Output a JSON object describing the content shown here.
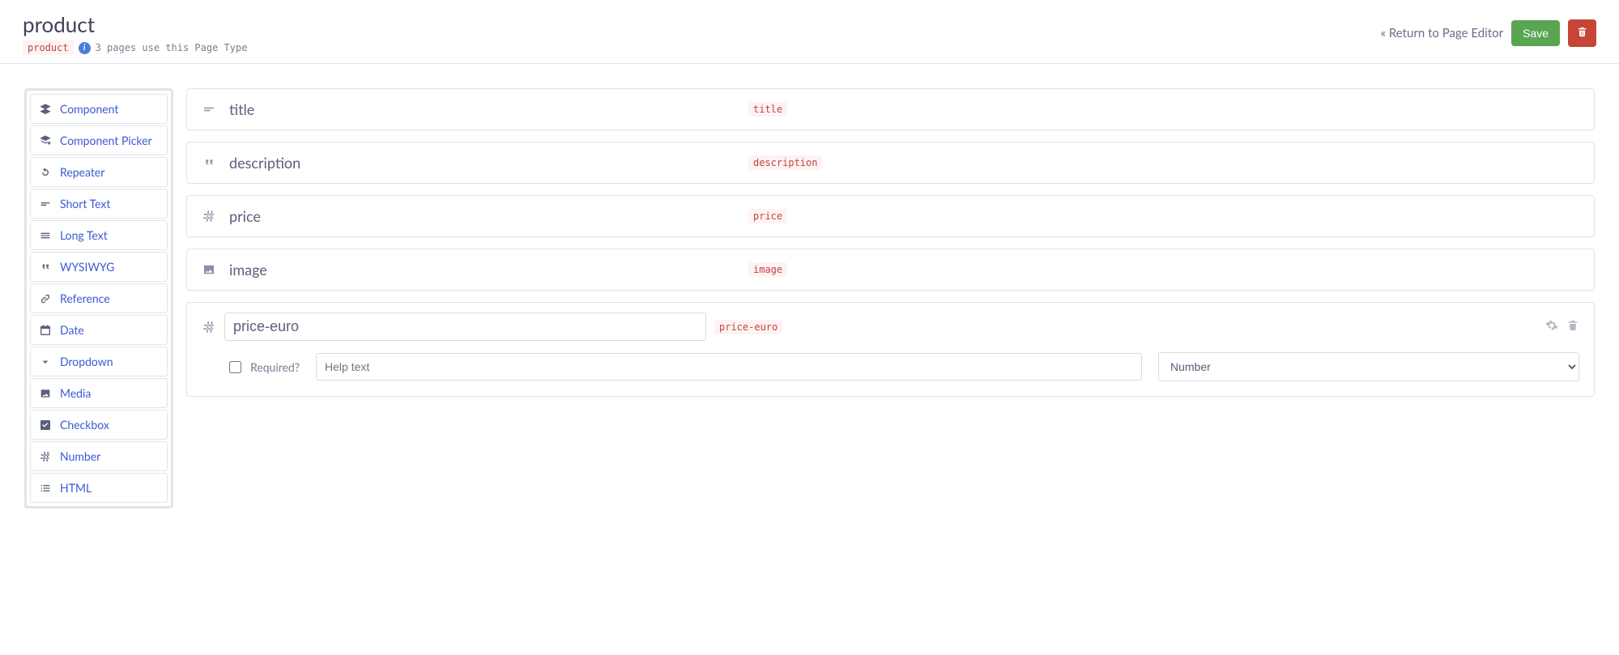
{
  "header": {
    "title": "product",
    "slug": "product",
    "usage_text": "3 pages use this Page Type",
    "return_label": "« Return to Page Editor",
    "save_label": "Save"
  },
  "sidebar": {
    "items": [
      {
        "icon": "layers-icon",
        "label": "Component"
      },
      {
        "icon": "layers-plus-icon",
        "label": "Component Picker"
      },
      {
        "icon": "refresh-icon",
        "label": "Repeater"
      },
      {
        "icon": "short-text-icon",
        "label": "Short Text"
      },
      {
        "icon": "long-text-icon",
        "label": "Long Text"
      },
      {
        "icon": "quote-icon",
        "label": "WYSIWYG"
      },
      {
        "icon": "link-icon",
        "label": "Reference"
      },
      {
        "icon": "calendar-icon",
        "label": "Date"
      },
      {
        "icon": "chevron-down-icon",
        "label": "Dropdown"
      },
      {
        "icon": "image-icon",
        "label": "Media"
      },
      {
        "icon": "checkbox-icon",
        "label": "Checkbox"
      },
      {
        "icon": "hash-icon",
        "label": "Number"
      },
      {
        "icon": "list-icon",
        "label": "HTML"
      }
    ]
  },
  "fields": [
    {
      "icon": "short-text-icon",
      "name": "title",
      "slug": "title"
    },
    {
      "icon": "quote-icon",
      "name": "description",
      "slug": "description"
    },
    {
      "icon": "hash-icon",
      "name": "price",
      "slug": "price"
    },
    {
      "icon": "image-icon",
      "name": "image",
      "slug": "image"
    }
  ],
  "editing_field": {
    "icon": "hash-icon",
    "name": "price-euro",
    "slug": "price-euro",
    "required_label": "Required?",
    "help_placeholder": "Help text",
    "type_value": "Number"
  }
}
